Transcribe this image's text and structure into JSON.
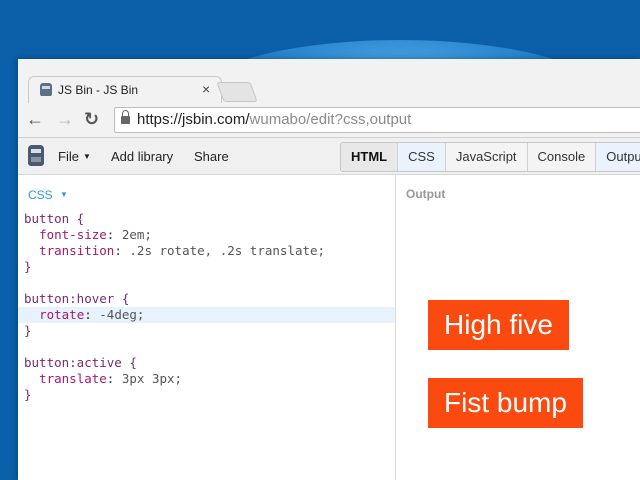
{
  "browser": {
    "tab_title": "JS Bin - JS Bin",
    "tab_close": "×",
    "url_host": "https://jsbin.com/",
    "url_path": "wumabo/edit?css,output",
    "nav": {
      "back": "←",
      "forward": "→",
      "reload": "↻"
    }
  },
  "toolbar": {
    "file": "File",
    "file_caret": "▼",
    "add_library": "Add library",
    "share": "Share",
    "panels": [
      "HTML",
      "CSS",
      "JavaScript",
      "Console",
      "Output"
    ],
    "active_panel": "HTML"
  },
  "editor": {
    "label": "CSS",
    "label_caret": "▼",
    "lines": [
      {
        "sel": "button {"
      },
      {
        "prop": "font-size",
        "val": "2em;"
      },
      {
        "prop": "transition",
        "val": ".2s rotate, .2s translate;"
      },
      {
        "sel": "}"
      },
      {
        "sel": ""
      },
      {
        "sel": "button:hover {"
      },
      {
        "prop": "rotate",
        "val": "-4deg;"
      },
      {
        "sel": "}"
      },
      {
        "sel": ""
      },
      {
        "sel": "button:active {"
      },
      {
        "prop": "translate",
        "val": "3px 3px;"
      },
      {
        "sel": "}"
      }
    ]
  },
  "output": {
    "label": "Output",
    "buttons": [
      "High five",
      "Fist bump"
    ]
  },
  "colors": {
    "desktop": "#0a5fa8",
    "demo_button": "#fa4a10",
    "accent": "#2d9be0"
  },
  "icons": {
    "favicon": "jsbin-favicon-icon",
    "lock": "lock-icon",
    "logo": "jsbin-logo-icon"
  }
}
